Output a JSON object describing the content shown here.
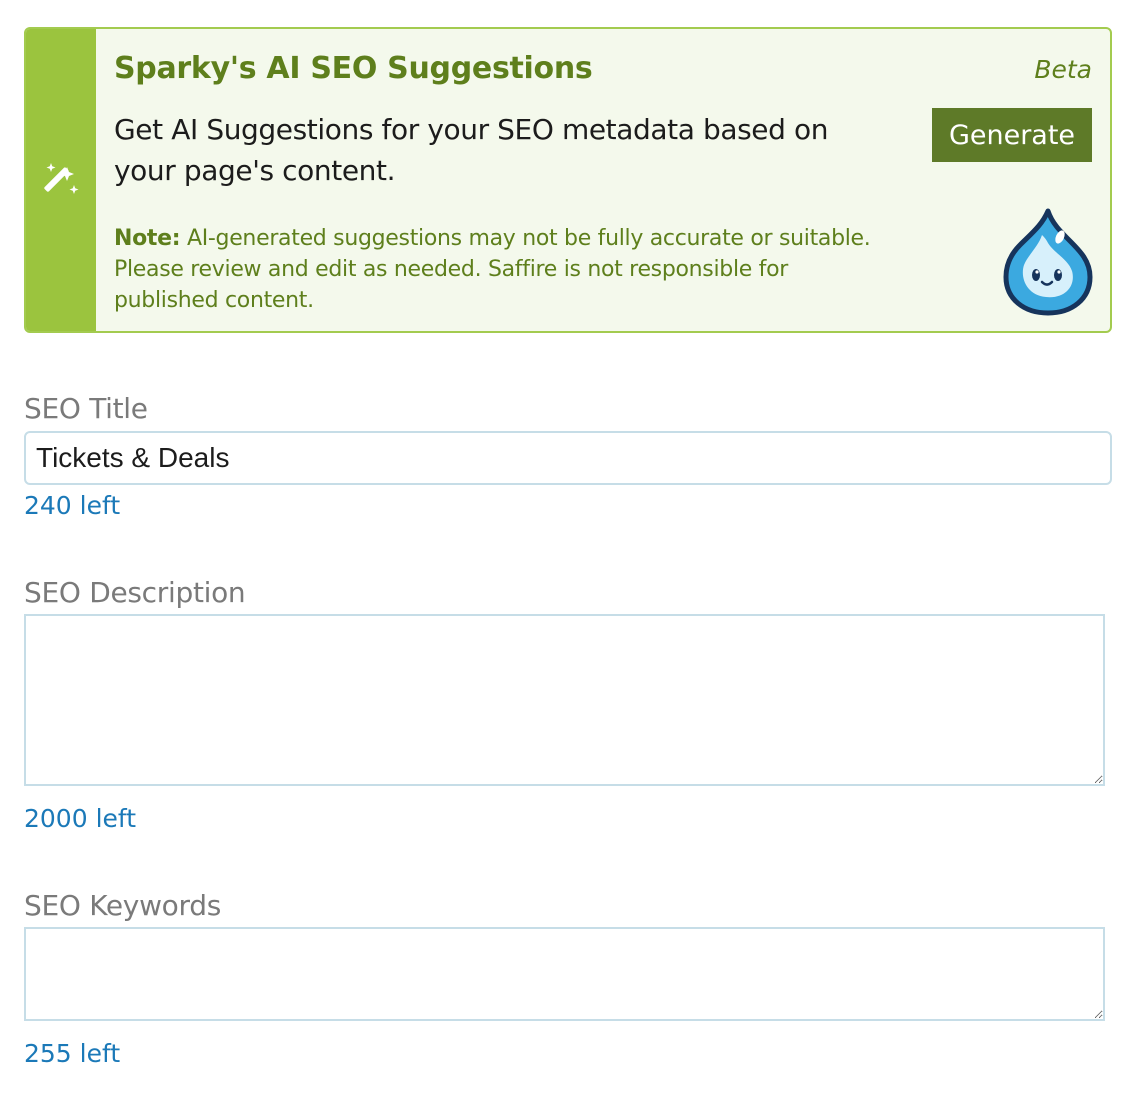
{
  "ai_panel": {
    "title": "Sparky's AI SEO Suggestions",
    "badge": "Beta",
    "description": "Get AI Suggestions for your SEO metadata based on your page's content.",
    "generate_label": "Generate",
    "note_label": "Note:",
    "note_text": " AI-generated suggestions may not be fully accurate or suitable. Please review and edit as needed. Saffire is not responsible for published content.",
    "wand_icon": "magic-wand-icon",
    "mascot_icon": "water-drop-mascot"
  },
  "fields": {
    "seo_title": {
      "label": "SEO Title",
      "value": "Tickets & Deals",
      "counter": "240 left"
    },
    "seo_description": {
      "label": "SEO Description",
      "value": "",
      "counter": "2000 left"
    },
    "seo_keywords": {
      "label": "SEO Keywords",
      "value": "",
      "counter": "255 left"
    }
  },
  "colors": {
    "accent_green": "#9bc43e",
    "dark_green": "#5e7f1c",
    "button_green": "#5e7a28",
    "panel_bg": "#f4f9ec",
    "counter_blue": "#1b79b8",
    "label_gray": "#7a7a7a"
  }
}
